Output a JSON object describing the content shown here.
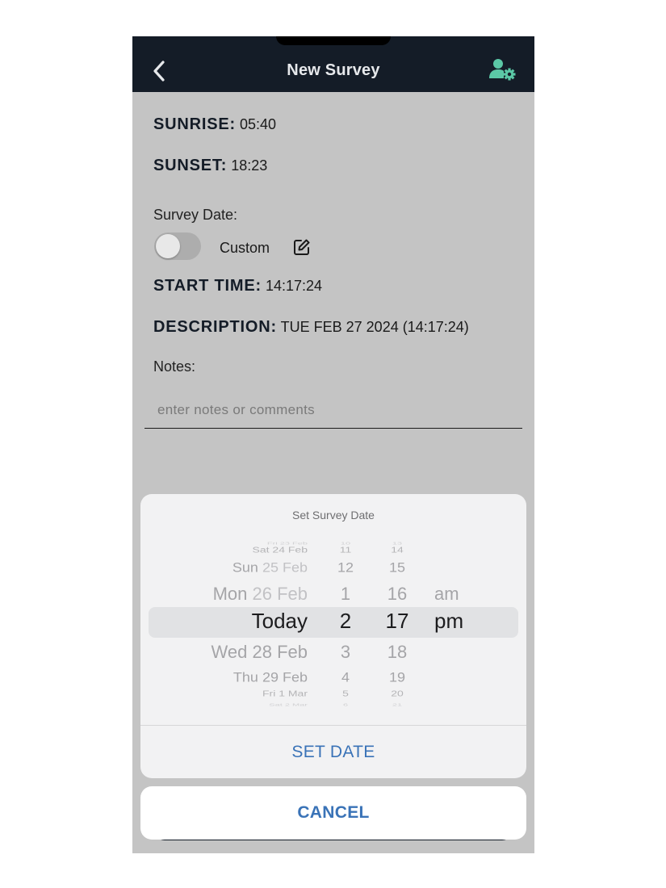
{
  "header": {
    "title": "New Survey",
    "back_icon": "chevron-left-icon",
    "settings_icon": "user-gear-icon",
    "accent_color": "#5bc8a6"
  },
  "info": {
    "sunrise_label": "SUNRISE:",
    "sunrise_value": "05:40",
    "sunset_label": "SUNSET:",
    "sunset_value": "18:23",
    "survey_date_label": "Survey Date:",
    "custom_label": "Custom",
    "custom_enabled": false,
    "start_time_label": "START TIME:",
    "start_time_value": "14:17:24",
    "description_label": "DESCRIPTION:",
    "description_value": "TUE FEB 27 2024 (14:17:24)",
    "notes_label": "Notes:",
    "notes_placeholder": "enter notes or comments",
    "notes_value": ""
  },
  "date_picker": {
    "title": "Set Survey Date",
    "date_column": [
      {
        "dow": "Fri",
        "date": "23 Feb"
      },
      {
        "dow": "Sat",
        "date": "24 Feb"
      },
      {
        "dow": "Sun",
        "date": "25 Feb"
      },
      {
        "dow": "Mon",
        "date": "26 Feb"
      },
      {
        "dow": "",
        "date": "Today"
      },
      {
        "dow": "Wed",
        "date": "28 Feb"
      },
      {
        "dow": "Thu",
        "date": "29 Feb"
      },
      {
        "dow": "Fri",
        "date": "1 Mar"
      },
      {
        "dow": "Sat",
        "date": "2 Mar"
      }
    ],
    "hour_column": [
      "10",
      "11",
      "12",
      "1",
      "2",
      "3",
      "4",
      "5",
      "6"
    ],
    "minute_column": [
      "13",
      "14",
      "15",
      "16",
      "17",
      "18",
      "19",
      "20",
      "21"
    ],
    "ampm_column": [
      "",
      "",
      "",
      "am",
      "pm",
      "",
      "",
      "",
      ""
    ],
    "selected_index": 4,
    "set_label": "SET DATE",
    "cancel_label": "CANCEL",
    "action_color": "#3a73b7"
  }
}
